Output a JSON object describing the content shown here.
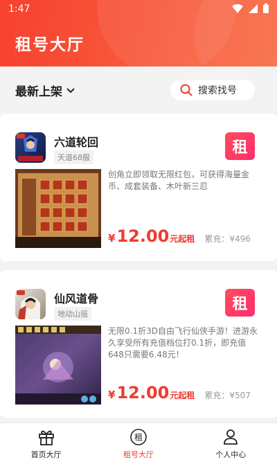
{
  "status_bar": {
    "time": "1:47"
  },
  "header": {
    "title": "租号大厅"
  },
  "filter": {
    "sort_label": "最新上架",
    "search_label": "搜索找号"
  },
  "rent_badge_label": "租",
  "cards": [
    {
      "game_name": "六道轮回",
      "server": "天道68服",
      "description": "创角立即领取无限红包，可获得海量金币、成套装备、木叶新三忍",
      "currency": "¥",
      "price": "12.00",
      "price_unit": "元起租",
      "recharge": "累充：¥496"
    },
    {
      "game_name": "仙风道骨",
      "server": "地动山摇",
      "description": "无限0.1折3D自由飞行仙侠手游！进游永久享受所有充值档位打0.1折，即充值648只需要6.48元！",
      "currency": "¥",
      "price": "12.00",
      "price_unit": "元起租",
      "recharge": "累充：¥507"
    }
  ],
  "tabs": [
    {
      "label": "首页大厅",
      "icon": "gift-icon",
      "active": false
    },
    {
      "label": "租号大厅",
      "icon": "rent-circle-icon",
      "active": true
    },
    {
      "label": "个人中心",
      "icon": "user-icon",
      "active": false
    }
  ],
  "colors": {
    "header_start": "#f7412f",
    "header_end": "#f86e4a",
    "accent": "#f03a2e",
    "badge": "#ff3366"
  }
}
